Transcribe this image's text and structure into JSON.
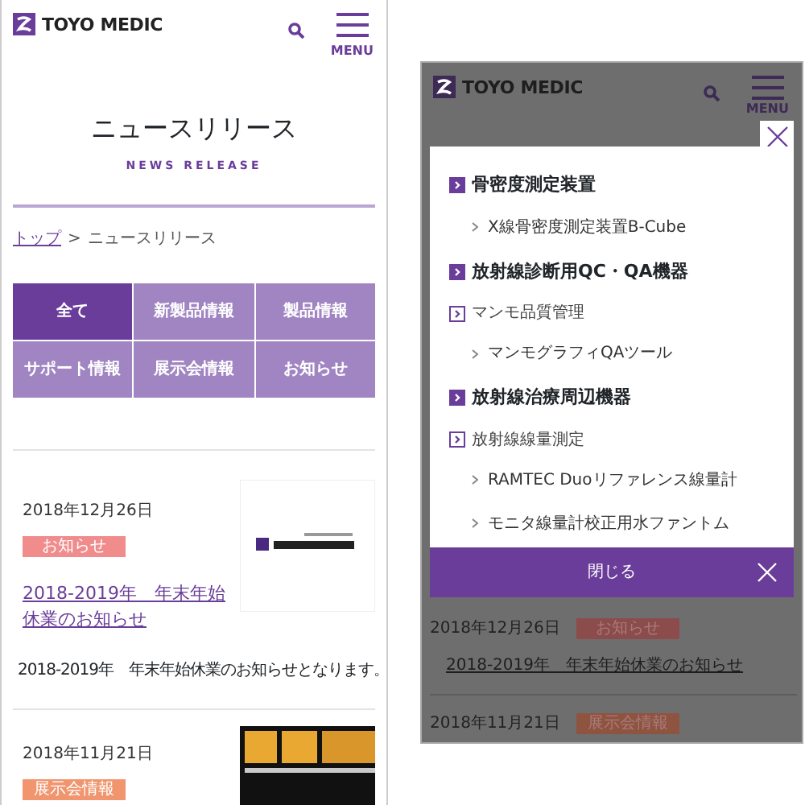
{
  "left_screen": {
    "header": {
      "logo": "TOYO MEDIC",
      "menu_label": "MENU"
    },
    "page_title": "ニュースリリース",
    "page_subtitle": "NEWS RELEASE",
    "breadcrumb": {
      "items": [
        "トップ",
        "ニュースリリース"
      ],
      "separator": ">"
    },
    "categories": [
      {
        "label": "全て",
        "selected": true
      },
      {
        "label": "新製品情報",
        "selected": false
      },
      {
        "label": "製品情報",
        "selected": false
      },
      {
        "label": "サポート情報",
        "selected": false
      },
      {
        "label": "展示会情報",
        "selected": false
      },
      {
        "label": "お知らせ",
        "selected": false
      }
    ],
    "articles": [
      {
        "date": "2018年12月26日",
        "tag": "お知らせ",
        "color": "#f08c8c",
        "title": "2018-2019年　年末年始休業のお知らせ",
        "excerpt": "2018-2019年　年末年始休業のお知らせとなります。"
      },
      {
        "date": "2018年11月21日",
        "tag": "展示会情報",
        "color": "#f0956e"
      }
    ]
  },
  "right_screen": {
    "header": {
      "logo": "TOYO MEDIC",
      "menu_label": "MENU"
    },
    "menu": [
      {
        "title": "骨密度測定装置",
        "children": [
          {
            "kind": "item",
            "label": "X線骨密度測定装置B-Cube"
          }
        ]
      },
      {
        "title": "放射線診断用QC・QA機器",
        "children": [
          {
            "kind": "category",
            "label": "マンモ品質管理"
          },
          {
            "kind": "item",
            "label": "マンモグラフィQAツール"
          }
        ]
      },
      {
        "title": "放射線治療周辺機器",
        "children": [
          {
            "kind": "category",
            "label": "放射線線量測定"
          },
          {
            "kind": "item",
            "label": "RAMTEC Duoリファレンス線量計"
          },
          {
            "kind": "item",
            "label": "モニタ線量計校正用水ファントム"
          }
        ]
      }
    ],
    "close_label": "閉じる",
    "articles": [
      {
        "date": "2018年12月26日",
        "tag": "お知らせ",
        "color": "#8c4c4c",
        "title": "2018-2019年　年末年始休業のお知らせ"
      },
      {
        "date": "2018年11月21日",
        "tag": "展示会情報",
        "color": "#8e5440"
      }
    ]
  }
}
